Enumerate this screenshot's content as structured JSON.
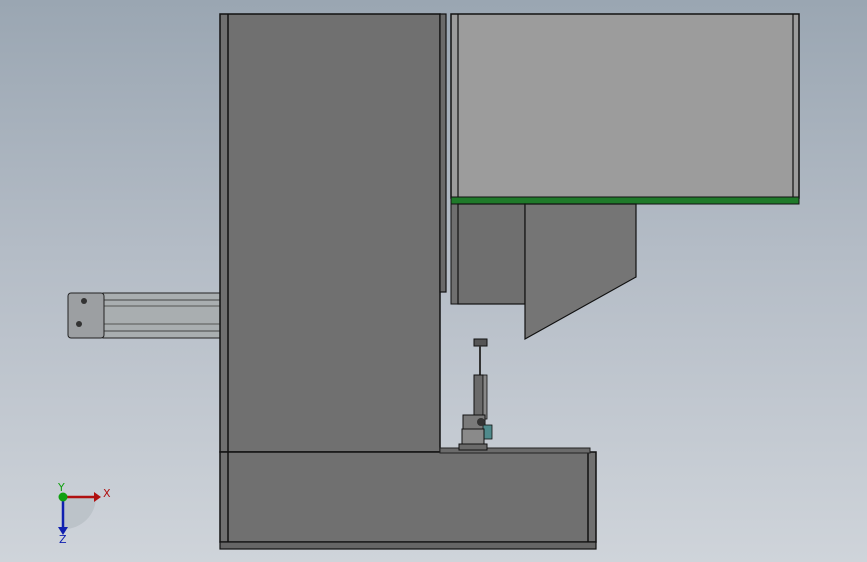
{
  "view": {
    "colors": {
      "frame": "#6f6f6f",
      "frame_edge": "#1a1a1a",
      "hopper": "#9b9b9b",
      "plate_accent": "#1f7a2a",
      "rail": "#a7acae",
      "background_top": "#9aa6b2",
      "background_bottom": "#cfd4da"
    }
  },
  "triad": {
    "x_label": "X",
    "y_label": "Y",
    "z_label": "Z",
    "x_color": "#b01010",
    "y_color": "#10a010",
    "z_color": "#1020b0"
  }
}
